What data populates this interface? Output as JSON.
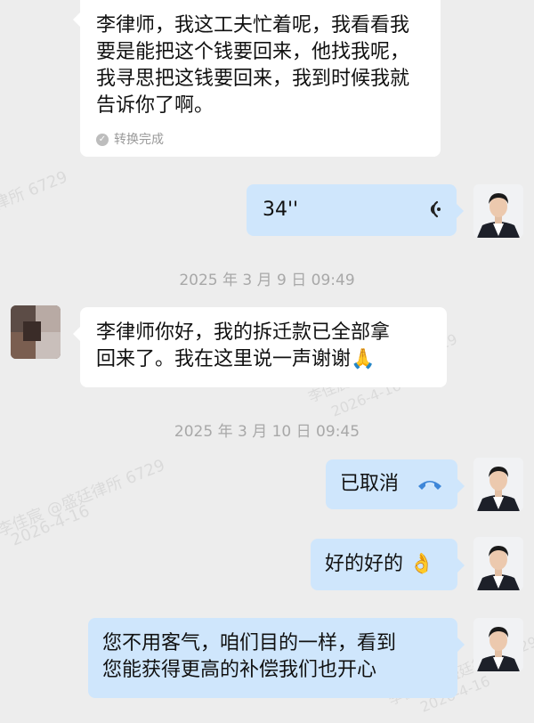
{
  "watermarks": [
    "律所 6729",
    "李佳宸 @盛廷律所 6729",
    "2026-4-16",
    "李佳宸 @盛廷律所 6729",
    "2026-4-16",
    "李佳宸 @盛廷律所 6729",
    "2026-4-16"
  ],
  "messages": {
    "m1": {
      "lines": [
        "李律师，我这工夫忙着呢，我看看我",
        "要是能把这个钱要回来，他找我呢，",
        "我寻思把这钱要回来，我到时候我就",
        "告诉你了啊。"
      ],
      "conversion_status": "转换完成"
    },
    "m2": {
      "duration": "34''"
    },
    "ts1": "2025 年 3 月 9 日 09:49",
    "m3": {
      "lines": [
        "李律师你好，我的拆迁款已全部拿",
        "回来了。我在这里说一声谢谢"
      ],
      "emoji": "🙏"
    },
    "ts2": "2025 年 3 月 10 日 09:45",
    "m4": {
      "text": "已取消"
    },
    "m5": {
      "text": "好的好的",
      "emoji": "👌"
    },
    "m6": {
      "lines": [
        "您不用客气，咱们目的一样，看到",
        "您能获得更高的补偿我们也开心"
      ]
    }
  },
  "colors": {
    "background": "#ededed",
    "bubble_in": "#ffffff",
    "bubble_out": "#cfe6fc",
    "call_icon": "#3d86d8"
  }
}
